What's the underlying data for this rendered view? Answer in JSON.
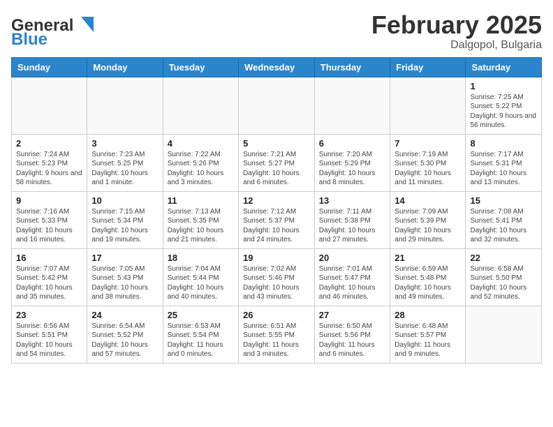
{
  "header": {
    "logo_general": "General",
    "logo_blue": "Blue",
    "month_year": "February 2025",
    "location": "Dalgopol, Bulgaria"
  },
  "weekdays": [
    "Sunday",
    "Monday",
    "Tuesday",
    "Wednesday",
    "Thursday",
    "Friday",
    "Saturday"
  ],
  "weeks": [
    [
      {
        "day": "",
        "info": ""
      },
      {
        "day": "",
        "info": ""
      },
      {
        "day": "",
        "info": ""
      },
      {
        "day": "",
        "info": ""
      },
      {
        "day": "",
        "info": ""
      },
      {
        "day": "",
        "info": ""
      },
      {
        "day": "1",
        "info": "Sunrise: 7:25 AM\nSunset: 5:22 PM\nDaylight: 9 hours and 56 minutes."
      }
    ],
    [
      {
        "day": "2",
        "info": "Sunrise: 7:24 AM\nSunset: 5:23 PM\nDaylight: 9 hours and 58 minutes."
      },
      {
        "day": "3",
        "info": "Sunrise: 7:23 AM\nSunset: 5:25 PM\nDaylight: 10 hours and 1 minute."
      },
      {
        "day": "4",
        "info": "Sunrise: 7:22 AM\nSunset: 5:26 PM\nDaylight: 10 hours and 3 minutes."
      },
      {
        "day": "5",
        "info": "Sunrise: 7:21 AM\nSunset: 5:27 PM\nDaylight: 10 hours and 6 minutes."
      },
      {
        "day": "6",
        "info": "Sunrise: 7:20 AM\nSunset: 5:29 PM\nDaylight: 10 hours and 8 minutes."
      },
      {
        "day": "7",
        "info": "Sunrise: 7:19 AM\nSunset: 5:30 PM\nDaylight: 10 hours and 11 minutes."
      },
      {
        "day": "8",
        "info": "Sunrise: 7:17 AM\nSunset: 5:31 PM\nDaylight: 10 hours and 13 minutes."
      }
    ],
    [
      {
        "day": "9",
        "info": "Sunrise: 7:16 AM\nSunset: 5:33 PM\nDaylight: 10 hours and 16 minutes."
      },
      {
        "day": "10",
        "info": "Sunrise: 7:15 AM\nSunset: 5:34 PM\nDaylight: 10 hours and 19 minutes."
      },
      {
        "day": "11",
        "info": "Sunrise: 7:13 AM\nSunset: 5:35 PM\nDaylight: 10 hours and 21 minutes."
      },
      {
        "day": "12",
        "info": "Sunrise: 7:12 AM\nSunset: 5:37 PM\nDaylight: 10 hours and 24 minutes."
      },
      {
        "day": "13",
        "info": "Sunrise: 7:11 AM\nSunset: 5:38 PM\nDaylight: 10 hours and 27 minutes."
      },
      {
        "day": "14",
        "info": "Sunrise: 7:09 AM\nSunset: 5:39 PM\nDaylight: 10 hours and 29 minutes."
      },
      {
        "day": "15",
        "info": "Sunrise: 7:08 AM\nSunset: 5:41 PM\nDaylight: 10 hours and 32 minutes."
      }
    ],
    [
      {
        "day": "16",
        "info": "Sunrise: 7:07 AM\nSunset: 5:42 PM\nDaylight: 10 hours and 35 minutes."
      },
      {
        "day": "17",
        "info": "Sunrise: 7:05 AM\nSunset: 5:43 PM\nDaylight: 10 hours and 38 minutes."
      },
      {
        "day": "18",
        "info": "Sunrise: 7:04 AM\nSunset: 5:44 PM\nDaylight: 10 hours and 40 minutes."
      },
      {
        "day": "19",
        "info": "Sunrise: 7:02 AM\nSunset: 5:46 PM\nDaylight: 10 hours and 43 minutes."
      },
      {
        "day": "20",
        "info": "Sunrise: 7:01 AM\nSunset: 5:47 PM\nDaylight: 10 hours and 46 minutes."
      },
      {
        "day": "21",
        "info": "Sunrise: 6:59 AM\nSunset: 5:48 PM\nDaylight: 10 hours and 49 minutes."
      },
      {
        "day": "22",
        "info": "Sunrise: 6:58 AM\nSunset: 5:50 PM\nDaylight: 10 hours and 52 minutes."
      }
    ],
    [
      {
        "day": "23",
        "info": "Sunrise: 6:56 AM\nSunset: 5:51 PM\nDaylight: 10 hours and 54 minutes."
      },
      {
        "day": "24",
        "info": "Sunrise: 6:54 AM\nSunset: 5:52 PM\nDaylight: 10 hours and 57 minutes."
      },
      {
        "day": "25",
        "info": "Sunrise: 6:53 AM\nSunset: 5:54 PM\nDaylight: 11 hours and 0 minutes."
      },
      {
        "day": "26",
        "info": "Sunrise: 6:51 AM\nSunset: 5:55 PM\nDaylight: 11 hours and 3 minutes."
      },
      {
        "day": "27",
        "info": "Sunrise: 6:50 AM\nSunset: 5:56 PM\nDaylight: 11 hours and 6 minutes."
      },
      {
        "day": "28",
        "info": "Sunrise: 6:48 AM\nSunset: 5:57 PM\nDaylight: 11 hours and 9 minutes."
      },
      {
        "day": "",
        "info": ""
      }
    ]
  ]
}
